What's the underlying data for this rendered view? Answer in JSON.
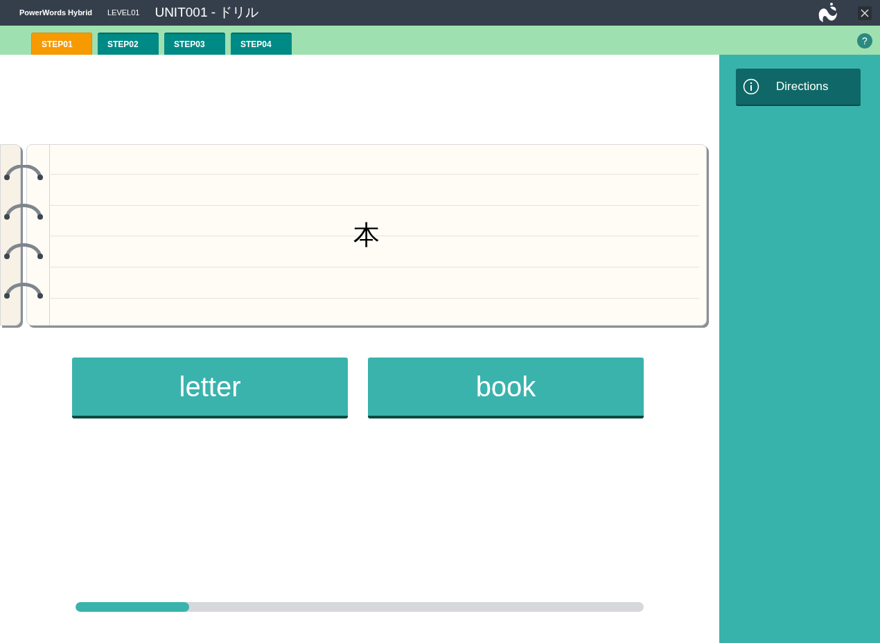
{
  "header": {
    "app_name": "PowerWords Hybrid",
    "level": "LEVEL01",
    "title": "UNIT001 - ドリル"
  },
  "tabs": [
    {
      "label": "STEP01",
      "selected": true
    },
    {
      "label": "STEP02",
      "selected": false
    },
    {
      "label": "STEP03",
      "selected": false
    },
    {
      "label": "STEP04",
      "selected": false
    }
  ],
  "help": "?",
  "question": {
    "word": "本"
  },
  "choices": [
    "letter",
    "book"
  ],
  "progress": {
    "level": 0.2
  },
  "sidebar": {
    "directions": "Directions"
  }
}
